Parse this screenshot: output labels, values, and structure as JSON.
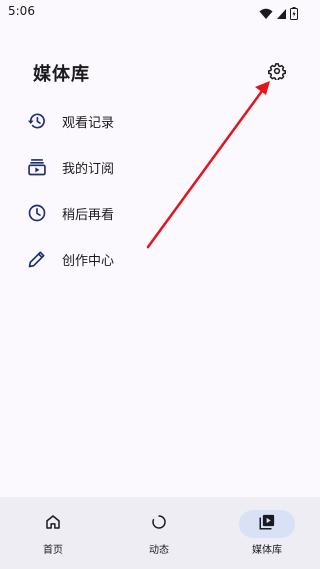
{
  "status": {
    "time": "5:06"
  },
  "page": {
    "title": "媒体库"
  },
  "menu": {
    "items": [
      {
        "label": "观看记录",
        "icon": "history-icon"
      },
      {
        "label": "我的订阅",
        "icon": "subscriptions-icon"
      },
      {
        "label": "稍后再看",
        "icon": "clock-icon"
      },
      {
        "label": "创作中心",
        "icon": "pencil-icon"
      }
    ]
  },
  "bottom_nav": {
    "items": [
      {
        "label": "首页",
        "icon": "home-icon",
        "active": false
      },
      {
        "label": "动态",
        "icon": "loading-circle-icon",
        "active": false
      },
      {
        "label": "媒体库",
        "icon": "video-library-icon",
        "active": true
      }
    ]
  },
  "colors": {
    "accent": "#1f2f6e",
    "annotation_arrow": "#e3141c",
    "nav_active_pill": "#d9e1f7",
    "background": "#fbf8fe"
  }
}
